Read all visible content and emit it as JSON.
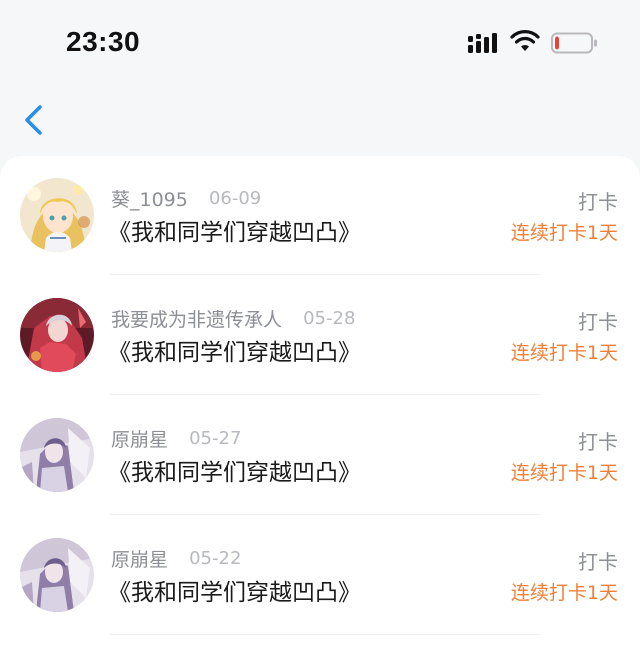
{
  "status_bar": {
    "time": "23:30",
    "icons": [
      "cellular-signal-icon",
      "wifi-icon",
      "battery-low-icon"
    ],
    "battery_level": 0.12,
    "battery_color": "#e5453a"
  },
  "nav": {
    "back_icon": "chevron-left-icon",
    "accent_color": "#2a8fe6"
  },
  "records": [
    {
      "username": "葵_1095",
      "date": "06-09",
      "book_title": "《我和同学们穿越凹凸》",
      "action": "打卡",
      "streak": "连续打卡1天",
      "avatar": "anime-girl-blonde-avatar"
    },
    {
      "username": "我要成为非遗传承人",
      "date": "05-28",
      "book_title": "《我和同学们穿越凹凸》",
      "action": "打卡",
      "streak": "连续打卡1天",
      "avatar": "anime-character-red-avatar"
    },
    {
      "username": "原崩星",
      "date": "05-27",
      "book_title": "《我和同学们穿越凹凸》",
      "action": "打卡",
      "streak": "连续打卡1天",
      "avatar": "anime-character-lavender-avatar"
    },
    {
      "username": "原崩星",
      "date": "05-22",
      "book_title": "《我和同学们穿越凹凸》",
      "action": "打卡",
      "streak": "连续打卡1天",
      "avatar": "anime-character-lavender-avatar"
    }
  ],
  "colors": {
    "streak": "#ef7f3a",
    "username": "#8d8f96",
    "date": "#b7b9be",
    "title": "#1a1a1a"
  }
}
